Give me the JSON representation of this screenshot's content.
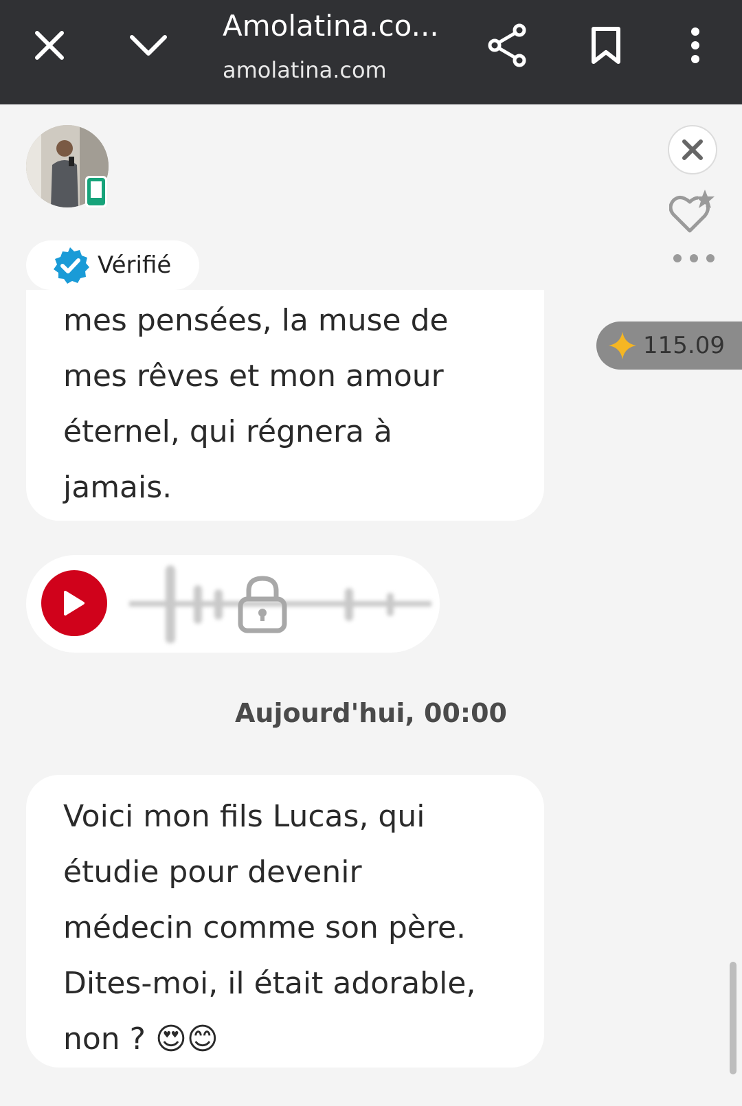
{
  "browser": {
    "title": "Amolatina.co...",
    "url": "amolatina.com",
    "close_icon": "close-icon",
    "minimize_icon": "chevron-down-icon",
    "share_icon": "share-icon",
    "bookmark_icon": "bookmark-icon",
    "menu_icon": "more-vert-icon"
  },
  "profile": {
    "verified_label": "Vérifié",
    "device_icon": "mobile-phone-icon"
  },
  "actions": {
    "close_icon": "close-icon",
    "favorite_icon": "heart-star-icon",
    "more_icon": "more-horiz-icon"
  },
  "credits": {
    "value": "115.09",
    "icon": "sparkle-icon"
  },
  "messages": [
    {
      "lines": [
        "mes pensées, la muse de",
        "mes rêves et mon amour",
        "éternel, qui régnera à",
        "jamais."
      ]
    },
    {
      "type": "voice",
      "play_icon": "play-icon",
      "lock_icon": "lock-icon"
    },
    {
      "lines": [
        "Voici mon fils Lucas, qui",
        "étudie pour devenir",
        "médecin comme son père.",
        "Dites-moi, il était adorable,",
        "non ? 😍😊"
      ]
    }
  ],
  "date_separator": "Aujourd'hui, 00:00",
  "colors": {
    "topbar": "#303134",
    "play": "#d0021b",
    "verified": "#1a9bd7",
    "device_badge": "#17a37a",
    "sparkle": "#f5b623"
  }
}
